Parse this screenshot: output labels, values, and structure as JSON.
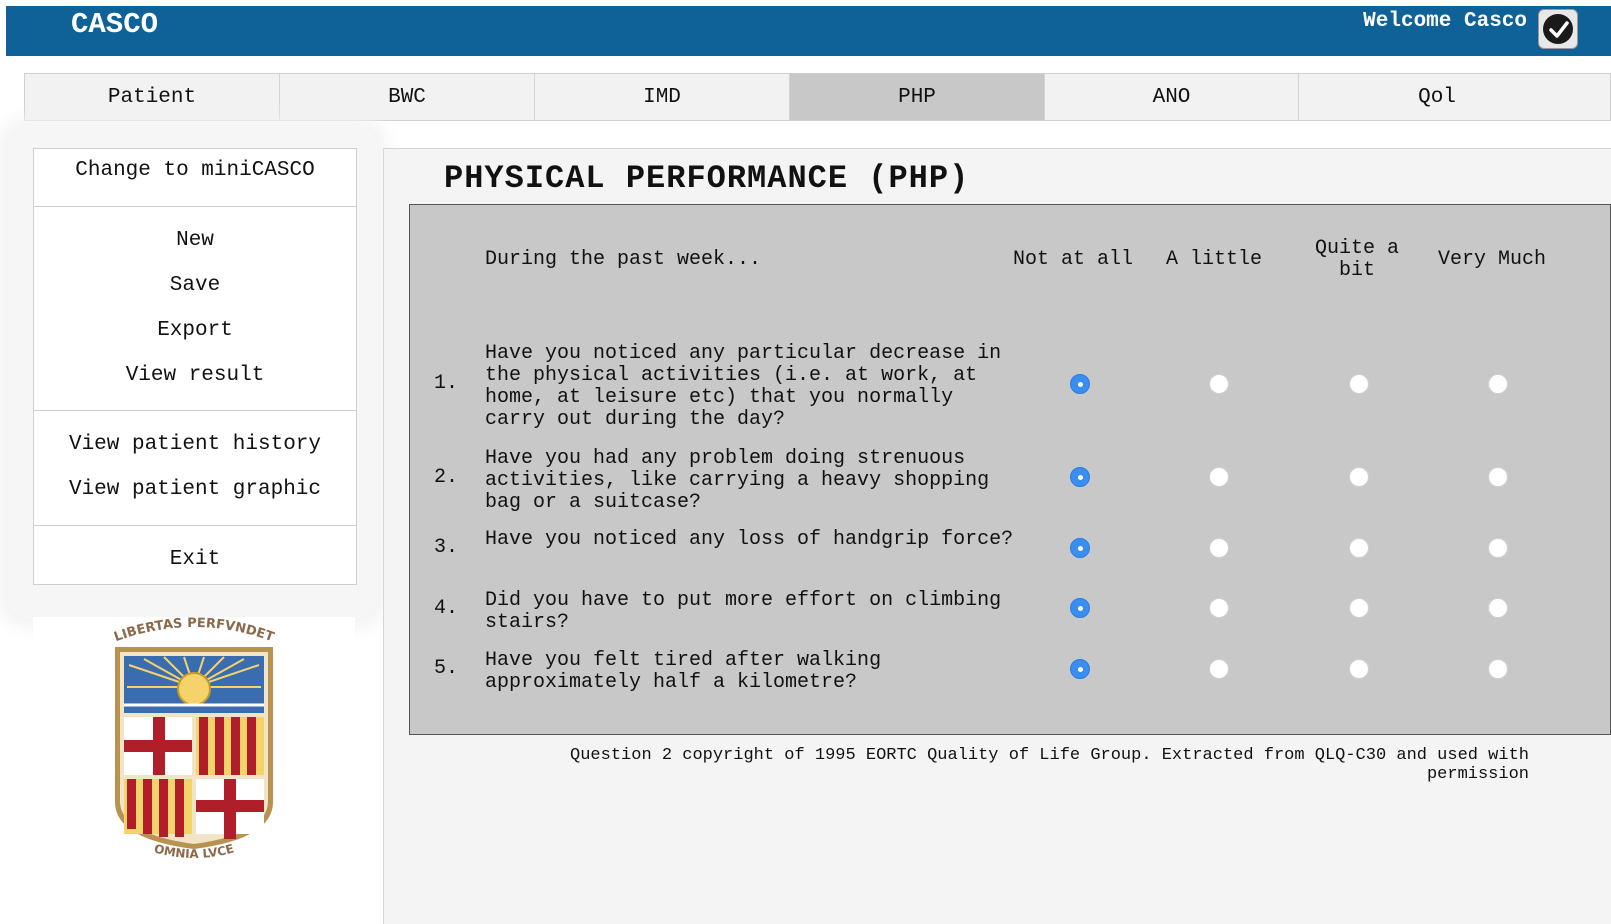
{
  "header": {
    "app_title": "CASCO",
    "welcome": "Welcome Casco",
    "accent_color": "#0e6298"
  },
  "tabs": [
    {
      "label": "Patient",
      "active": false
    },
    {
      "label": "BWC",
      "active": false
    },
    {
      "label": "IMD",
      "active": false
    },
    {
      "label": "PHP",
      "active": true
    },
    {
      "label": "ANO",
      "active": false
    },
    {
      "label": "Qol",
      "active": false
    }
  ],
  "sidebar": {
    "change_label": "Change to miniCASCO",
    "actions": [
      "New",
      "Save",
      "Export",
      "View result"
    ],
    "history": [
      "View patient history",
      "View patient graphic"
    ],
    "exit_label": "Exit",
    "logo": {
      "top_text": "LIBERTAS PERFVNDET",
      "bottom_text": "OMNIA LVCE"
    }
  },
  "main": {
    "title": "PHYSICAL PERFORMANCE (PHP)",
    "prompt": "During the past week...",
    "options": [
      "Not at all",
      "A little",
      "Quite a bit",
      "Very Much"
    ],
    "questions": [
      {
        "num": "1.",
        "text": "Have you noticed any particular decrease in the physical activities (i.e. at work, at home, at leisure etc) that you normally carry out during the day?",
        "selected": 0
      },
      {
        "num": "2.",
        "text": "Have you had any problem doing strenuous activities, like carrying a heavy shopping bag or a suitcase?",
        "selected": 0
      },
      {
        "num": "3.",
        "text": "Have you noticed any loss of handgrip force?",
        "selected": 0
      },
      {
        "num": "4.",
        "text": "Did you have to put more effort on climbing stairs?",
        "selected": 0
      },
      {
        "num": "5.",
        "text": "Have you felt tired after walking approximately half a kilometre?",
        "selected": 0
      }
    ],
    "copyright": "Question 2 copyright of 1995 EORTC Quality of Life Group. Extracted from QLQ-C30 and used with permission"
  }
}
